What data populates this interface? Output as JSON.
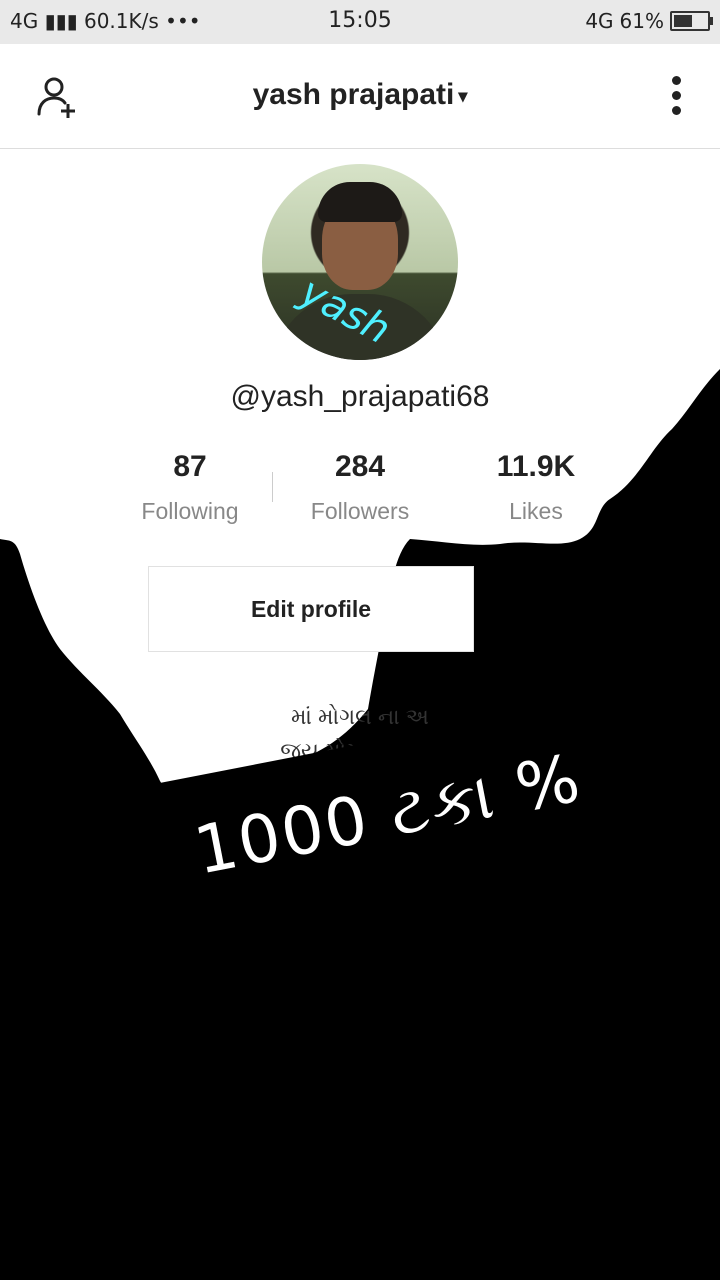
{
  "status_bar": {
    "network_left": "4G",
    "speed": "60.1K/s",
    "dots": "•••",
    "time": "15:05",
    "network_right": "4G",
    "battery": "61%",
    "battery_level": 0.61
  },
  "header": {
    "title": "yash prajapati",
    "caret": "▾",
    "add_user_icon": "add-user-icon",
    "more_icon": "more-vertical-icon"
  },
  "profile": {
    "avatar_text": "yash",
    "handle": "@yash_prajapati68",
    "stats": [
      {
        "value": "87",
        "label": "Following"
      },
      {
        "value": "284",
        "label": "Followers"
      },
      {
        "value": "11.9K",
        "label": "Likes"
      }
    ],
    "edit_button": "Edit profile",
    "bio_line1": "માં મોગલ ના અ",
    "bio_line2": "જય મોગલ",
    "bio_emoji": "🙏🙏"
  },
  "overlay": {
    "banner_text": "1000 ટકા %"
  },
  "colors": {
    "status_bg": "#e9e9e9",
    "header_bg": "#ffffff",
    "text_primary": "#222222",
    "text_muted": "#888888",
    "accent_overlay": "#4ff0ff",
    "page_bg": "#000000"
  }
}
